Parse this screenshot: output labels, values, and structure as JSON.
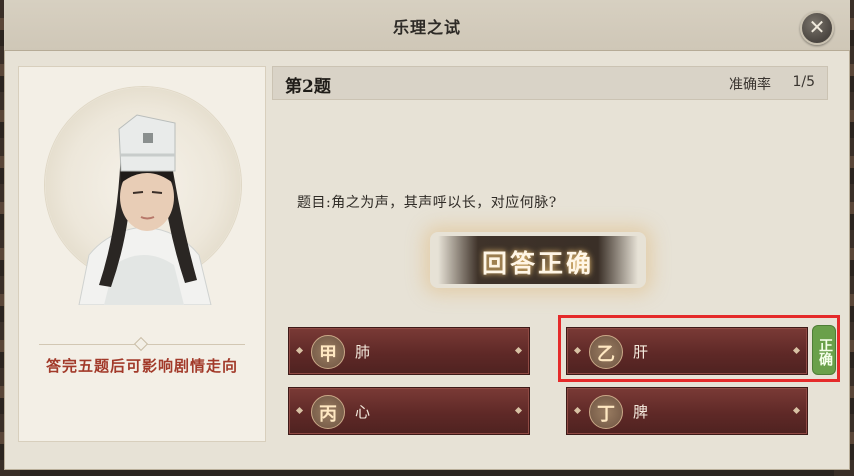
{
  "window": {
    "title": "乐理之试",
    "close_icon": "close-icon"
  },
  "portrait": {
    "hint": "答完五题后可影响剧情走向"
  },
  "question": {
    "number_label": "第2题",
    "accuracy_label": "准确率",
    "accuracy_value": "1/5",
    "text": "题目:角之为声，其声呼以长，对应何脉?"
  },
  "result_banner": "回答正确",
  "options": [
    {
      "badge": "甲",
      "label": "肺"
    },
    {
      "badge": "乙",
      "label": "肝"
    },
    {
      "badge": "丙",
      "label": "心"
    },
    {
      "badge": "丁",
      "label": "脾"
    }
  ],
  "correct_tag": "正确",
  "colors": {
    "accent_red": "#e52a2a",
    "correct_green": "#6aa04a",
    "option_bg": "#5f2927",
    "hint_text": "#a23a2a"
  }
}
